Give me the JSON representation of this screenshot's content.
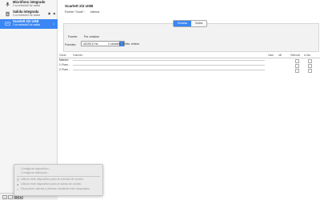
{
  "sidebar": {
    "devices": [
      {
        "name": "Micrófono integrado",
        "sub": "2 ca entrada/0 de salida"
      },
      {
        "name": "Salida integrada",
        "sub": "0 ca entrada/2 de salida"
      },
      {
        "name": "Scarlett 2i2 USB",
        "sub": "2 ca entrada/2 de salida"
      }
    ],
    "bottom_buttons": {
      "add": "+",
      "remove": "−",
      "gear": "⚙",
      "arrow": "▾"
    }
  },
  "main": {
    "title": "Scarlett 2i2 USB",
    "clock_label": "Fuente \"Clock\":",
    "clock_value": "Interna",
    "tabs": [
      {
        "label": "Entrada",
        "active": true
      },
      {
        "label": "Salida",
        "active": false
      }
    ],
    "format_label": "Fuente:",
    "format_value": "Por omisión",
    "format2_label": "Formato:",
    "format2_select": "44100,0 Hz",
    "format2_value": "2 canales/24 bits, entero",
    "table": {
      "headers": [
        "Canal",
        "Volumen",
        "Valor",
        "dB",
        "Silenciar",
        "A trav."
      ],
      "rows": [
        "Maestro",
        "1: Fuen...",
        "2: Fuen..."
      ]
    }
  },
  "context_menu": {
    "items": [
      {
        "label": "Configurar dispositivo..."
      },
      {
        "label": "Configurar altavoces..."
      },
      {
        "label": "Utilizar este dispositivo para la entrada de sonido",
        "icon": "mic-icon"
      },
      {
        "label": "Utilizar este dispositivo para la salida de sonido",
        "icon": "speaker-icon"
      },
      {
        "label": "Reproducir alertas y efectos mediante este dispositivo",
        "icon": "bell-icon"
      }
    ]
  },
  "colors": {
    "accent": "#3a86f3"
  }
}
